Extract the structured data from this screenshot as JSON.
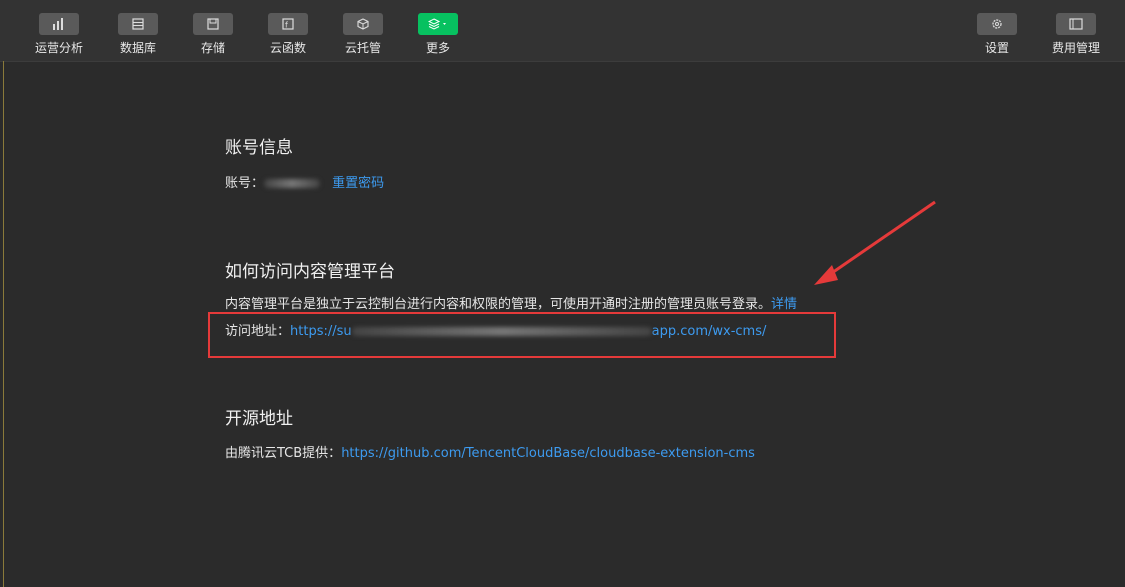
{
  "toolbar": {
    "items": [
      {
        "label": "运营分析",
        "icon": "analytics-icon"
      },
      {
        "label": "数据库",
        "icon": "database-icon"
      },
      {
        "label": "存储",
        "icon": "storage-icon"
      },
      {
        "label": "云函数",
        "icon": "cloud-function-icon"
      },
      {
        "label": "云托管",
        "icon": "cloud-hosting-icon"
      },
      {
        "label": "更多",
        "icon": "layers-icon"
      }
    ],
    "right_items": [
      {
        "label": "设置",
        "icon": "gear-icon"
      },
      {
        "label": "费用管理",
        "icon": "billing-icon"
      }
    ],
    "more_accent_color": "#07c160"
  },
  "account": {
    "heading": "账号信息",
    "label": "账号：",
    "reset_password": "重置密码"
  },
  "access": {
    "heading": "如何访问内容管理平台",
    "description": "内容管理平台是独立于云控制台进行内容和权限的管理，可使用开通时注册的管理员账号登录。",
    "details_link": "详情",
    "address_label": "访问地址：",
    "url_start": "https://su",
    "url_end": "app.com/wx-cms/"
  },
  "opensource": {
    "heading": "开源地址",
    "label": "由腾讯云TCB提供：",
    "url": "https://github.com/TencentCloudBase/cloudbase-extension-cms"
  },
  "annotation_color": "#e53a3a",
  "link_color": "#3d9bf0"
}
